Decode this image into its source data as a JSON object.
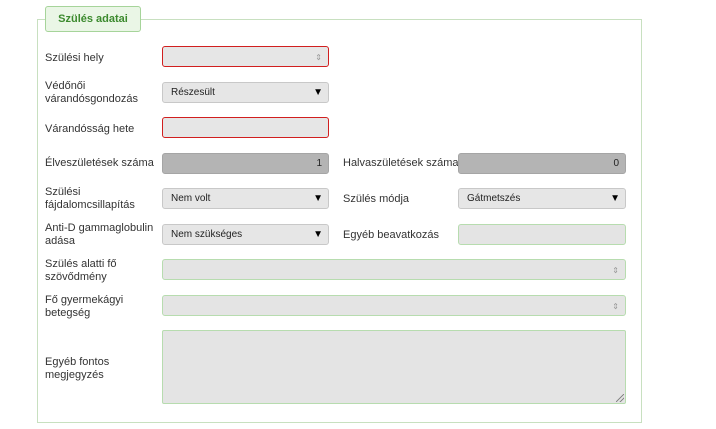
{
  "section": {
    "title": "Szülés adatai"
  },
  "fields": {
    "birth_place": {
      "label": "Szülési hely",
      "value": ""
    },
    "prenatal_care": {
      "label": "Védőnői várandósgondozás",
      "value": "Részesült"
    },
    "pregnancy_week": {
      "label": "Várandósság hete",
      "value": ""
    },
    "live_births": {
      "label": "Élveszületések száma",
      "value": "1"
    },
    "stillbirths": {
      "label": "Halvaszületések száma",
      "value": "0"
    },
    "pain_relief": {
      "label": "Szülési fájdalomcsillapítás",
      "value": "Nem volt"
    },
    "delivery_mode": {
      "label": "Szülés módja",
      "value": "Gátmetszés"
    },
    "anti_d": {
      "label": "Anti-D gammaglobulin adása",
      "value": "Nem szükséges"
    },
    "other_intervention": {
      "label": "Egyéb beavatkozás",
      "value": ""
    },
    "main_complication": {
      "label": "Szülés alatti fő szövődmény",
      "value": ""
    },
    "main_infant_disease": {
      "label": "Fő gyermekágyi betegség",
      "value": ""
    },
    "other_notes": {
      "label": "Egyéb fontos megjegyzés",
      "value": ""
    }
  },
  "icons": {
    "dropdown": "▼",
    "spinner": "⇕"
  },
  "colors": {
    "accent": "#3c8a2e",
    "required_border": "#d11f1f",
    "valid_border": "#b7dcaf"
  }
}
